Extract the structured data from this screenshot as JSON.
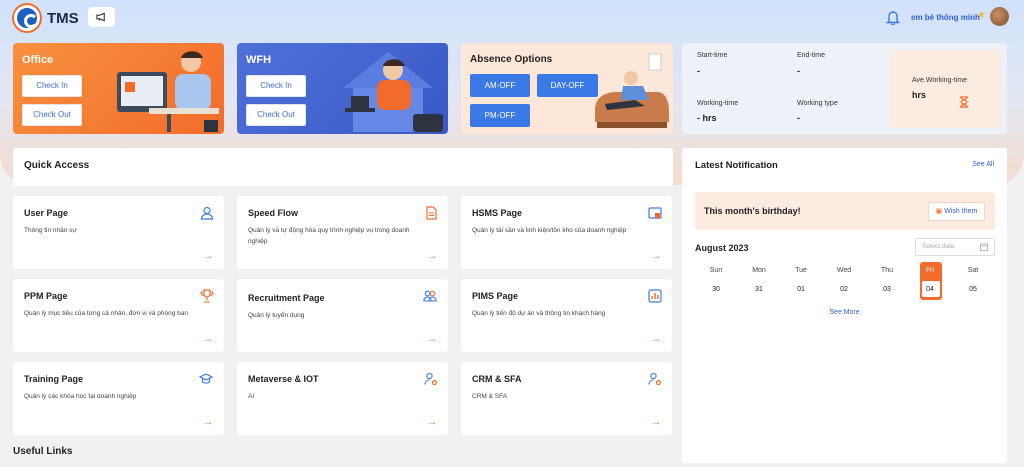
{
  "app": {
    "title": "TMS",
    "user_name": "em bé thông minh"
  },
  "attendance": {
    "office": {
      "title": "Office",
      "check_in": "Check In",
      "check_out": "Check Out"
    },
    "wfh": {
      "title": "WFH",
      "check_in": "Check In",
      "check_out": "Check Out"
    },
    "absence": {
      "title": "Absence Options",
      "am_off": "AM-OFF",
      "day_off": "DAY-OFF",
      "pm_off": "PM-OFF"
    }
  },
  "summary": {
    "start_time_label": "Start-time",
    "start_time": "-",
    "end_time_label": "End-time",
    "end_time": "-",
    "working_time_label": "Working-time",
    "working_time": "- hrs",
    "working_type_label": "Working type",
    "working_type": "-",
    "ave_label": "Ave.Working-time",
    "ave_value": "hrs"
  },
  "quick_access": {
    "title": "Quick Access",
    "tiles": [
      {
        "title": "User Page",
        "desc": "Thông tin nhân sự",
        "icon": "user-icon"
      },
      {
        "title": "Speed Flow",
        "desc": "Quản lý và tự động hóa quy trình nghiệp vụ trong doanh nghiệp",
        "icon": "document-icon"
      },
      {
        "title": "HSMS Page",
        "desc": "Quản lý tài sản và linh kiện/tồn kho của doanh nghiệp",
        "icon": "inventory-icon"
      },
      {
        "title": "PPM Page",
        "desc": "Quản lý mục tiêu của từng cá nhân, đơn vị và phòng ban",
        "icon": "trophy-icon"
      },
      {
        "title": "Recruitment Page",
        "desc": "Quản lý tuyển dụng",
        "icon": "people-icon"
      },
      {
        "title": "PIMS Page",
        "desc": "Quản lý tiến độ dự án và thông tin khách hàng",
        "icon": "chart-icon"
      },
      {
        "title": "Training Page",
        "desc": "Quản lý các khóa học tại doanh nghiệp",
        "icon": "graduation-cap-icon"
      },
      {
        "title": "Metaverse & IOT",
        "desc": "AI",
        "icon": "user-gear-icon"
      },
      {
        "title": "CRM & SFA",
        "desc": "CRM & SFA",
        "icon": "user-gear-icon"
      }
    ]
  },
  "useful_links": {
    "title": "Useful Links"
  },
  "notification": {
    "title": "Latest Notification",
    "see_all": "See All",
    "birthday_text": "This month's birthday!",
    "wish_label": "Wish them",
    "month_label": "August 2023",
    "date_placeholder": "Select date",
    "weekdays": [
      "Sun",
      "Mon",
      "Tue",
      "Wed",
      "Thu",
      "Fri",
      "Sat"
    ],
    "days": [
      "30",
      "31",
      "01",
      "02",
      "03",
      "04",
      "05"
    ],
    "today_index": 5,
    "see_more": "See More"
  },
  "colors": {
    "accent": "#f26b2b",
    "primary": "#3b7ae6",
    "link": "#2e5fd8"
  }
}
